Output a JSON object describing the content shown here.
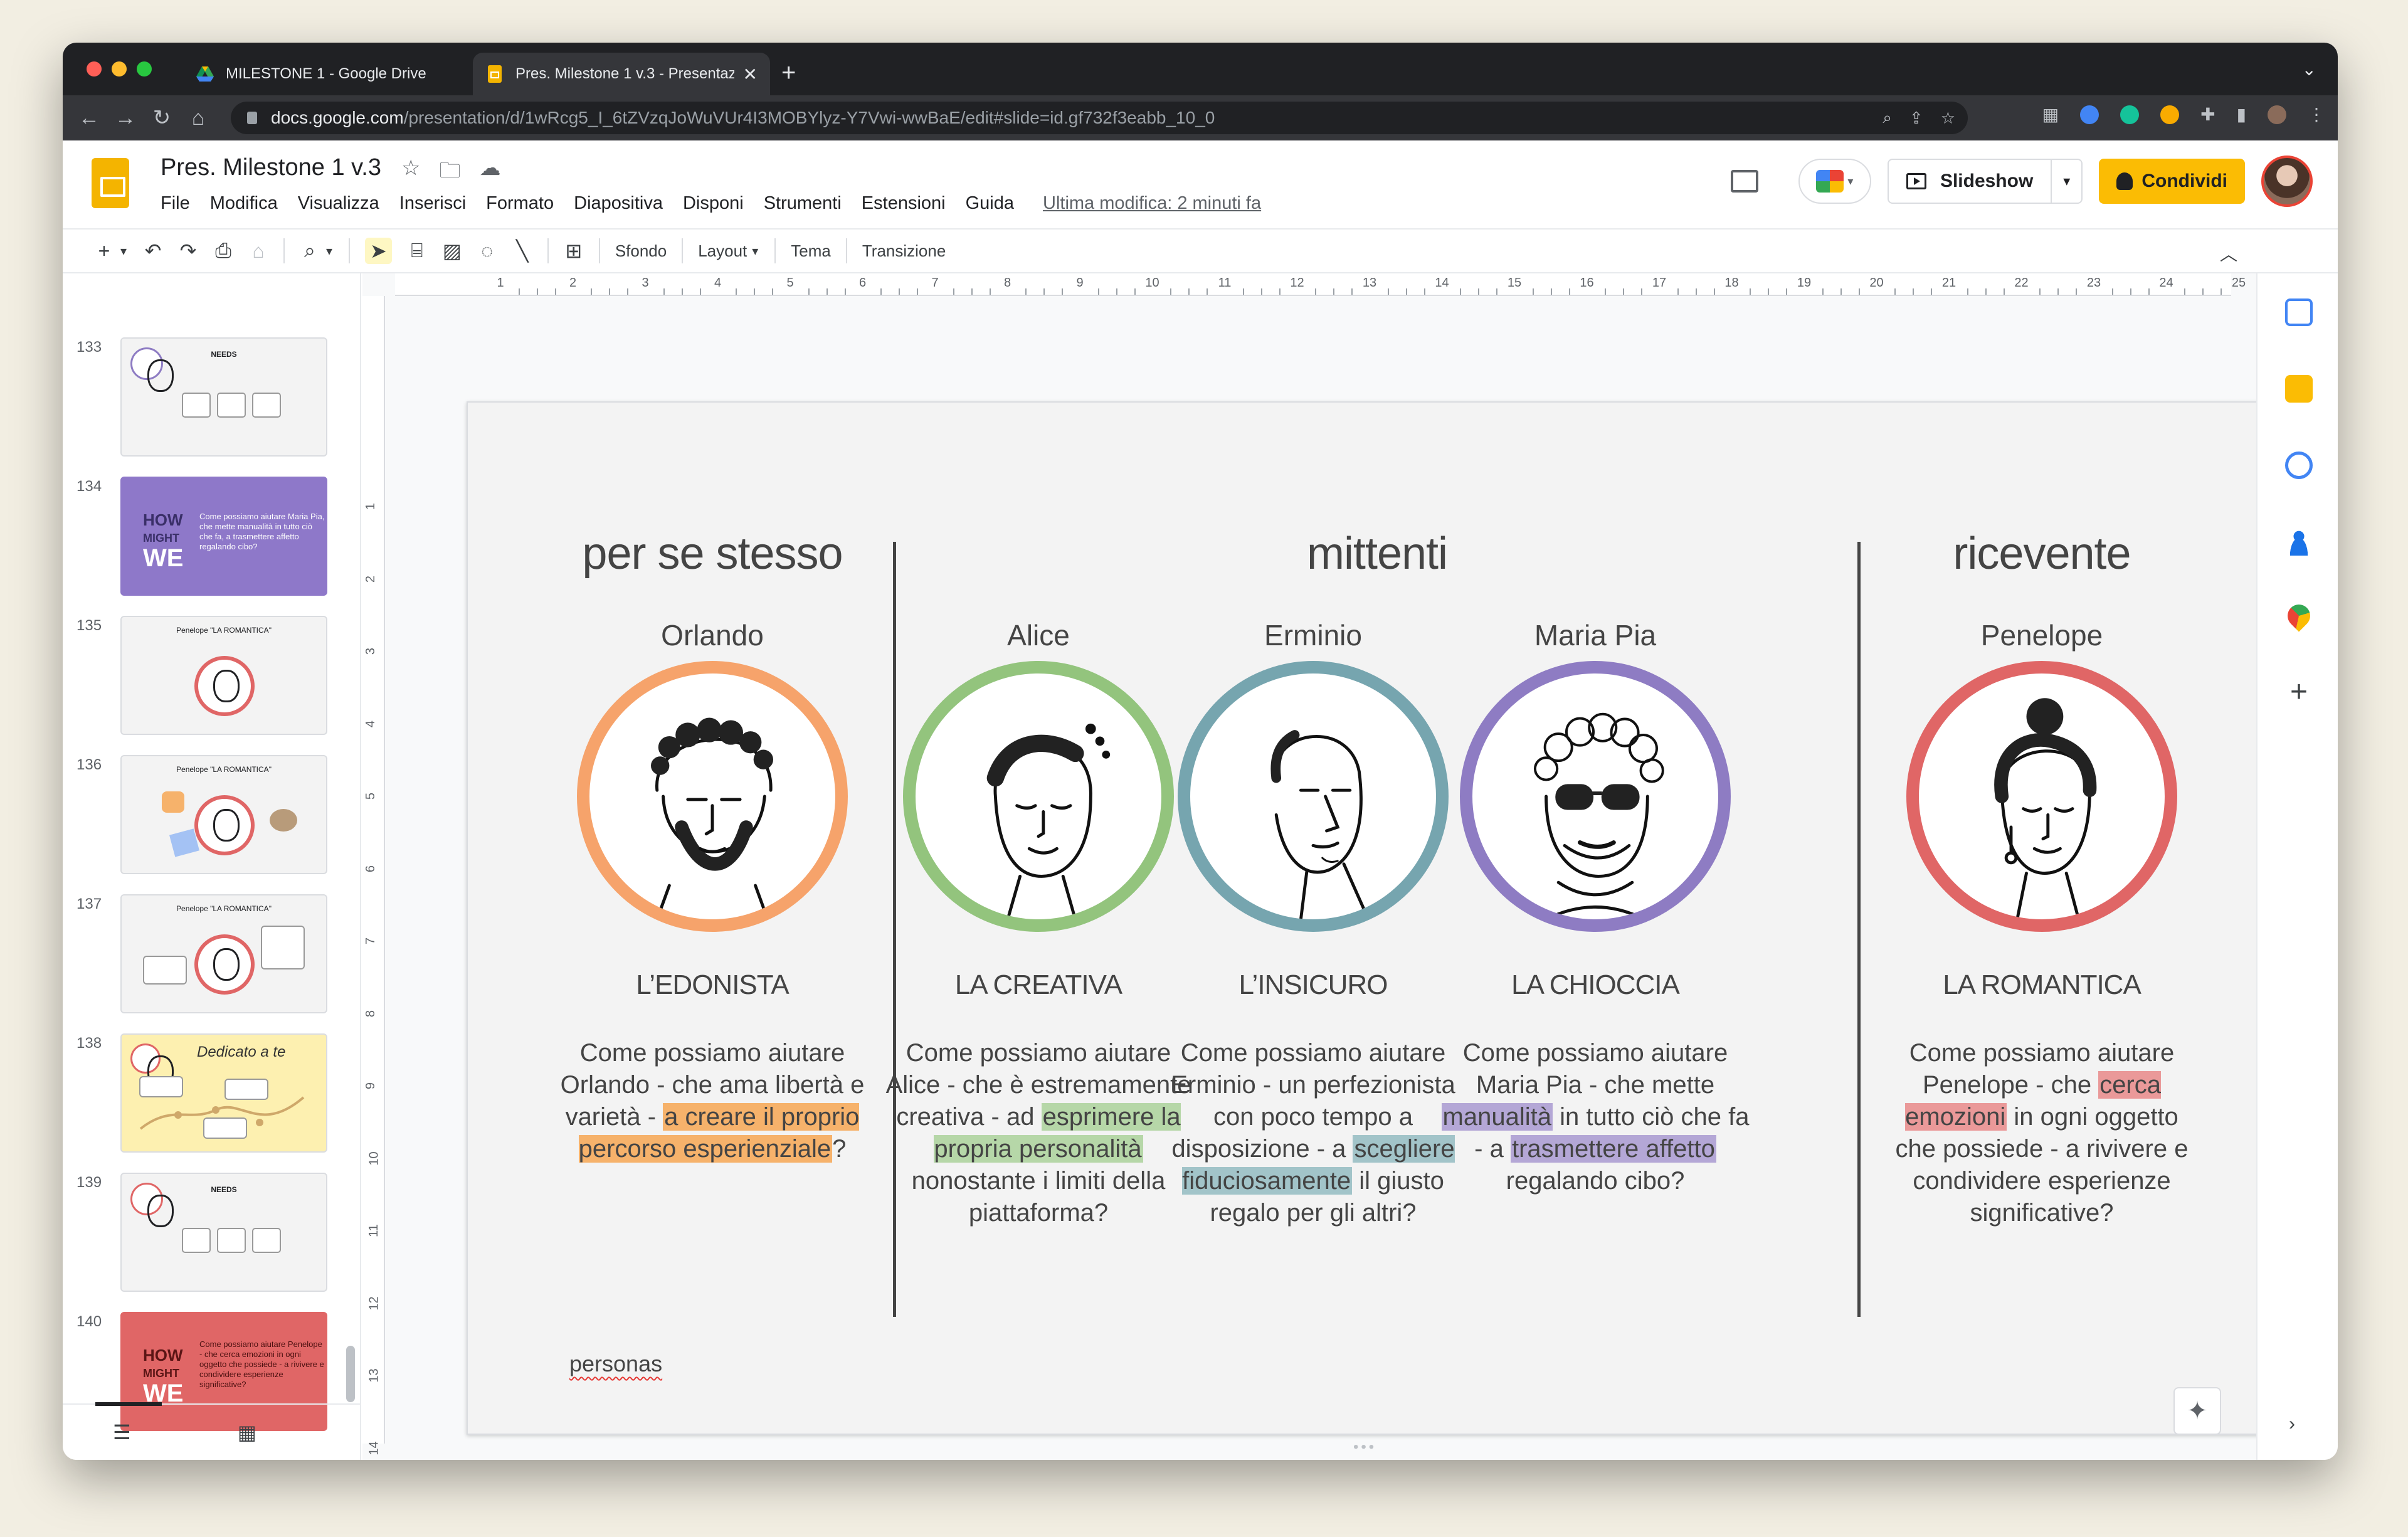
{
  "browser": {
    "tabs": [
      {
        "label": "MILESTONE 1 - Google Drive",
        "active": false
      },
      {
        "label": "Pres. Milestone 1 v.3 - Presentazione",
        "active": true
      }
    ],
    "url_host": "docs.google.com",
    "url_path": "/presentation/d/1wRcg5_I_6tZVzqJoWuVUr4I3MOBYlyz-Y7Vwi-wwBaE/edit#slide=id.gf732f3eabb_10_0"
  },
  "doc": {
    "title": "Pres. Milestone 1 v.3",
    "menu": [
      "File",
      "Modifica",
      "Visualizza",
      "Inserisci",
      "Formato",
      "Diapositiva",
      "Disponi",
      "Strumenti",
      "Estensioni",
      "Guida"
    ],
    "last_edit": "Ultima modifica: 2 minuti fa",
    "slideshow_label": "Slideshow",
    "share_label": "Condividi"
  },
  "toolbar": {
    "background_label": "Sfondo",
    "layout_label": "Layout",
    "theme_label": "Tema",
    "transition_label": "Transizione"
  },
  "filmstrip": {
    "slides": [
      {
        "num": "133",
        "kind": "needs",
        "title": "NEEDS"
      },
      {
        "num": "134",
        "kind": "hmw-purple",
        "hmw_line1": "HOW",
        "hmw_line2": "MIGHT",
        "hmw_line3": "WE",
        "text": "Come possiamo aiutare Maria Pia, che mette manualità in tutto ciò che fa, a trasmettere affetto regalando cibo?"
      },
      {
        "num": "135",
        "kind": "persona",
        "title": "Penelope \"LA ROMANTICA\""
      },
      {
        "num": "136",
        "kind": "persona-objects",
        "title": "Penelope \"LA ROMANTICA\""
      },
      {
        "num": "137",
        "kind": "persona-bubbles",
        "title": "Penelope \"LA ROMANTICA\""
      },
      {
        "num": "138",
        "kind": "journey",
        "title": "Dedicato a te"
      },
      {
        "num": "139",
        "kind": "needs",
        "title": "NEEDS"
      },
      {
        "num": "140",
        "kind": "hmw-red",
        "hmw_line1": "HOW",
        "hmw_line2": "MIGHT",
        "hmw_line3": "WE",
        "text": "Come possiamo aiutare Penelope - che cerca emozioni in ogni oggetto che possiede - a rivivere e condividere esperienze significative?"
      }
    ]
  },
  "ruler": {
    "h": [
      "1",
      "2",
      "3",
      "4",
      "5",
      "6",
      "7",
      "8",
      "9",
      "10",
      "11",
      "12",
      "13",
      "14",
      "15",
      "16",
      "17",
      "18",
      "19",
      "20",
      "21",
      "22",
      "23",
      "24",
      "25"
    ],
    "v": [
      "1",
      "2",
      "3",
      "4",
      "5",
      "6",
      "7",
      "8",
      "9",
      "10",
      "11",
      "12",
      "13",
      "14"
    ]
  },
  "slide": {
    "groups": [
      {
        "title": "per se stesso"
      },
      {
        "title": "mittenti"
      },
      {
        "title": "ricevente"
      }
    ],
    "personas": [
      {
        "name": "Orlando",
        "role": "L’EDONISTA",
        "color": "#f6a36b",
        "highlight": "#f6b26b",
        "desc_pre": "Come possiamo aiutare Orlando - che ama libertà e varietà - ",
        "desc_hl": "a creare il proprio percorso esperienziale",
        "desc_post": "?"
      },
      {
        "name": "Alice",
        "role": "LA CREATIVA",
        "color": "#93c47d",
        "highlight": "#b6d7a8",
        "desc_pre": "Come possiamo aiutare Alice - che è estremamente creativa - ad ",
        "desc_hl": "esprimere la propria personalità",
        "desc_post": " nonostante i limiti della piattaforma?"
      },
      {
        "name": "Erminio",
        "role": "L’INSICURO",
        "color": "#76a5af",
        "highlight": "#a2c4c9",
        "desc_pre": "Come possiamo aiutare Erminio - un perfezionista con poco tempo a disposizione - a ",
        "desc_hl": "scegliere fiduciosamente",
        "desc_post": " il giusto regalo per gli altri?"
      },
      {
        "name": "Maria Pia",
        "role": "LA CHIOCCIA",
        "color": "#8e7cc3",
        "highlight": "#b4a7d6",
        "desc_pre": "Come possiamo aiutare Maria Pia - che mette ",
        "desc_hl": "manualità",
        "desc_mid": " in tutto ciò che fa - a ",
        "desc_hl2": "trasmettere affetto",
        "desc_post": " regalando cibo?"
      },
      {
        "name": "Penelope",
        "role": "LA ROMANTICA",
        "color": "#e06666",
        "highlight": "#ea9999",
        "desc_pre": "Come possiamo aiutare Penelope - che ",
        "desc_hl": "cerca emozioni",
        "desc_post": " in ogni oggetto che possiede - a rivivere e condividere esperienze significative?"
      }
    ],
    "footer": "personas"
  },
  "icons": {
    "star": "star-icon",
    "move": "folder-move-icon",
    "cloud": "cloud-saved-icon",
    "comment": "comment-icon",
    "meet": "meet-icon"
  }
}
